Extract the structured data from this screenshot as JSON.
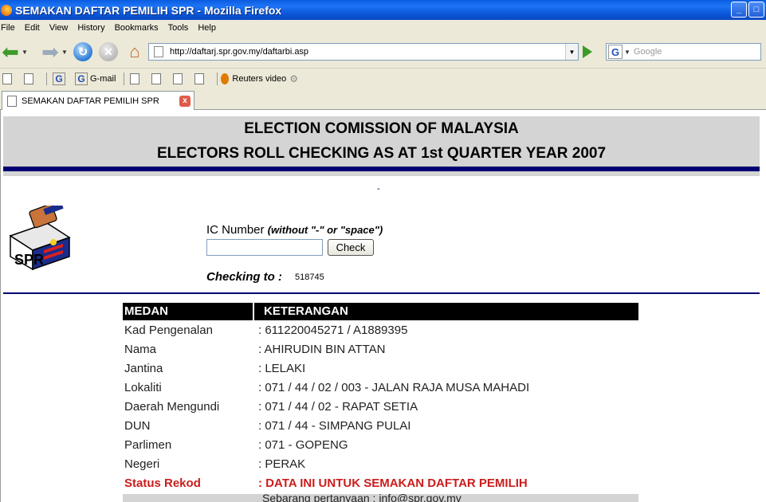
{
  "window": {
    "title": "SEMAKAN DAFTAR PEMILIH SPR - Mozilla Firefox",
    "minimize": "_",
    "close": "□"
  },
  "menu": [
    "File",
    "Edit",
    "View",
    "History",
    "Bookmarks",
    "Tools",
    "Help"
  ],
  "nav": {
    "url": "http://daftarj.spr.gov.my/daftarbi.asp",
    "search_placeholder": "Google"
  },
  "bookmarks": {
    "gmail": "G-mail",
    "reuters": "Reuters video"
  },
  "tab": {
    "label": "SEMAKAN DAFTAR PEMILIH SPR",
    "close": "x"
  },
  "page": {
    "header_line1": "ELECTION COMISSION OF MALAYSIA",
    "header_line2": "ELECTORS ROLL CHECKING AS AT 1st QUARTER YEAR 2007",
    "dash": "-",
    "ic_label": "IC Number",
    "ic_hint": "(without \"-\" or \"space\")",
    "ic_value": "",
    "check_button": "Check",
    "checking_label": "Checking to :",
    "checking_value": "518745",
    "logo_text": "SPR"
  },
  "table": {
    "headers": [
      "MEDAN",
      "KETERANGAN"
    ],
    "rows": [
      {
        "key": "Kad Pengenalan",
        "value": ": 611220045271 / A1889395"
      },
      {
        "key": "Nama",
        "value": ": AHIRUDIN BIN ATTAN"
      },
      {
        "key": "Jantina",
        "value": ": LELAKI"
      },
      {
        "key": "Lokaliti",
        "value": ": 071 / 44 / 02 / 003 - JALAN RAJA MUSA MAHADI"
      },
      {
        "key": "Daerah Mengundi",
        "value": ": 071 / 44 / 02 - RAPAT SETIA"
      },
      {
        "key": "DUN",
        "value": ": 071 / 44 - SIMPANG PULAI"
      },
      {
        "key": "Parlimen",
        "value": ": 071 - GOPENG"
      },
      {
        "key": "Negeri",
        "value": ": PERAK"
      }
    ],
    "status_key": "Status Rekod",
    "status_value": ": DATA INI UNTUK SEMAKAN DAFTAR PEMILIH",
    "footer": "Sebarang pertanyaan : info@spr.gov.my"
  },
  "colors": {
    "header_bg": "#d4d4d4",
    "rule": "#000073",
    "status": "#cc1c1c",
    "table_head": "#000000"
  }
}
